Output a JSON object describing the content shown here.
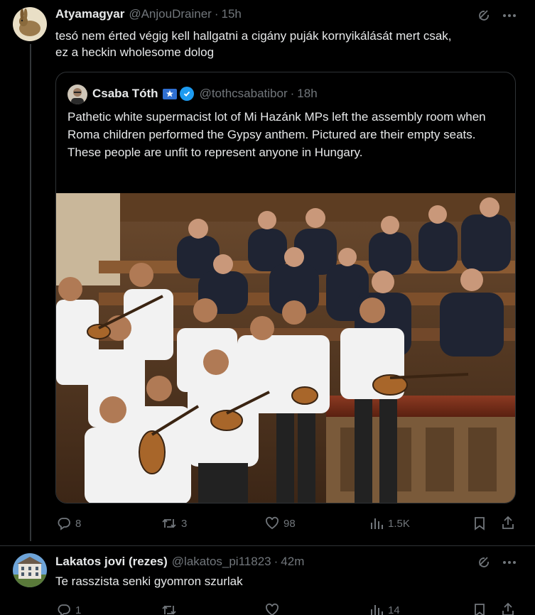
{
  "tweet1": {
    "name": "Atyamagyar",
    "handle": "@AnjouDrainer",
    "time": "15h",
    "text_line1": "tesó nem érted végig kell hallgatni a cigány puják kornyikálását mert csak,",
    "text_line2": "ez a heckin wholesome dolog",
    "quote": {
      "name": "Csaba Tóth",
      "handle": "@tothcsabatibor",
      "time": "18h",
      "text": "Pathetic white supermacist lot of Mi Hazánk MPs left the assembly room when Roma children performed the Gypsy anthem. Pictured are their empty seats. These people are unfit to represent anyone in Hungary."
    },
    "stats": {
      "replies": "8",
      "retweets": "3",
      "likes": "98",
      "views": "1.5K"
    }
  },
  "tweet2": {
    "name": "Lakatos jovi (rezes)",
    "handle": "@lakatos_pi11823",
    "time": "42m",
    "text": "Te rasszista senki gyomron szurlak",
    "stats": {
      "replies": "1",
      "retweets": "",
      "likes": "",
      "views": "14"
    }
  },
  "separator": "·",
  "colors": {
    "background": "#000000",
    "text": "#e7e9ea",
    "muted": "#71767b",
    "verified": "#1d9bf0",
    "border": "#2f3336"
  }
}
